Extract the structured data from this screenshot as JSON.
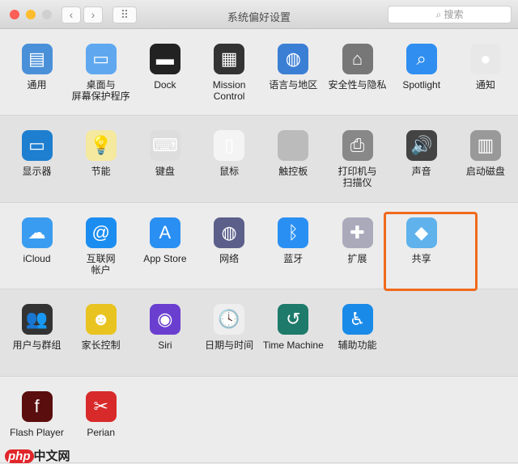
{
  "window": {
    "title": "系统偏好设置",
    "search_placeholder": "搜索",
    "back": "‹",
    "forward": "›",
    "grid": "⠿"
  },
  "sections": [
    [
      {
        "label": "通用",
        "icon": "file-icon",
        "color": "#4a90d9",
        "glyph": "▤"
      },
      {
        "label": "桌面与\n屏幕保护程序",
        "icon": "desktop-icon",
        "color": "#5fa8f0",
        "glyph": "▭"
      },
      {
        "label": "Dock",
        "icon": "dock-icon",
        "color": "#222",
        "glyph": "▬"
      },
      {
        "label": "Mission\nControl",
        "icon": "mission-control-icon",
        "color": "#333",
        "glyph": "▦"
      },
      {
        "label": "语言与地区",
        "icon": "globe-flag-icon",
        "color": "#3b7fd4",
        "glyph": "◍"
      },
      {
        "label": "安全性与隐私",
        "icon": "house-lock-icon",
        "color": "#777",
        "glyph": "⌂"
      },
      {
        "label": "Spotlight",
        "icon": "spotlight-icon",
        "color": "#2f8ef0",
        "glyph": "⌕"
      },
      {
        "label": "通知",
        "icon": "notification-icon",
        "color": "#e8e8e8",
        "glyph": "●"
      }
    ],
    [
      {
        "label": "显示器",
        "icon": "display-icon",
        "color": "#1e7fd0",
        "glyph": "▭"
      },
      {
        "label": "节能",
        "icon": "bulb-icon",
        "color": "#f5e9a0",
        "glyph": "💡"
      },
      {
        "label": "键盘",
        "icon": "keyboard-icon",
        "color": "#ddd",
        "glyph": "⌨"
      },
      {
        "label": "鼠标",
        "icon": "mouse-icon",
        "color": "#f4f4f4",
        "glyph": "▯"
      },
      {
        "label": "触控板",
        "icon": "trackpad-icon",
        "color": "#bbb",
        "glyph": ""
      },
      {
        "label": "打印机与\n扫描仪",
        "icon": "printer-icon",
        "color": "#888",
        "glyph": "⎙"
      },
      {
        "label": "声音",
        "icon": "speaker-icon",
        "color": "#444",
        "glyph": "🔊"
      },
      {
        "label": "启动磁盘",
        "icon": "disk-icon",
        "color": "#999",
        "glyph": "▥"
      }
    ],
    [
      {
        "label": "iCloud",
        "icon": "icloud-icon",
        "color": "#3a9cf0",
        "glyph": "☁"
      },
      {
        "label": "互联网\n帐户",
        "icon": "at-icon",
        "color": "#1b8df0",
        "glyph": "@"
      },
      {
        "label": "App Store",
        "icon": "app-store-icon",
        "color": "#2a8ff2",
        "glyph": "A"
      },
      {
        "label": "网络",
        "icon": "network-icon",
        "color": "#5b5f8a",
        "glyph": "◍"
      },
      {
        "label": "蓝牙",
        "icon": "bluetooth-icon",
        "color": "#2a8ff2",
        "glyph": "ᛒ"
      },
      {
        "label": "扩展",
        "icon": "puzzle-icon",
        "color": "#aab",
        "glyph": "✚"
      },
      {
        "label": "共享",
        "icon": "shared-folder-icon",
        "color": "#5fb2ec",
        "glyph": "◆"
      }
    ],
    [
      {
        "label": "用户与群组",
        "icon": "users-icon",
        "color": "#333",
        "glyph": "👥"
      },
      {
        "label": "家长控制",
        "icon": "parental-icon",
        "color": "#e9c320",
        "glyph": "☻"
      },
      {
        "label": "Siri",
        "icon": "siri-icon",
        "color": "#6a3fd0",
        "glyph": "◉"
      },
      {
        "label": "日期与时间",
        "icon": "clock-icon",
        "color": "#eee",
        "glyph": "🕓"
      },
      {
        "label": "Time Machine",
        "icon": "time-machine-icon",
        "color": "#1e7a6a",
        "glyph": "↺"
      },
      {
        "label": "辅助功能",
        "icon": "accessibility-icon",
        "color": "#1a8ae8",
        "glyph": "♿"
      }
    ],
    [
      {
        "label": "Flash Player",
        "icon": "flash-icon",
        "color": "#5a0e0e",
        "glyph": "f"
      },
      {
        "label": "Perian",
        "icon": "knife-icon",
        "color": "#d82a2a",
        "glyph": "✂"
      }
    ]
  ],
  "watermark": {
    "php": "php",
    "text": "中文网"
  },
  "colors": {
    "highlight": "#f06a1c"
  }
}
